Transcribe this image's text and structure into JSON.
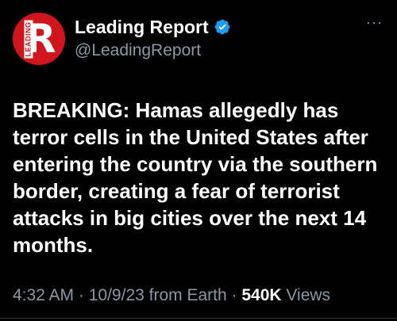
{
  "account": {
    "avatar_letter": "R",
    "avatar_word": "LEADING",
    "display_name": "Leading Report",
    "handle": "@LeadingReport",
    "verified_color": "#1d9bf0"
  },
  "menu": {
    "more_label": "···"
  },
  "tweet": {
    "text": "BREAKING: Hamas allegedly has terror cells in the United States after entering the country via the southern border, creating a fear of terrorist attacks in big cities over the next 14 months."
  },
  "meta": {
    "time": "4:32 AM",
    "date": "10/9/23",
    "source": "from Earth",
    "separator": " · ",
    "views_count": "540K",
    "views_label": "Views"
  },
  "colors": {
    "background": "#000000",
    "brand_red": "#d0151c",
    "muted": "#8b98a5"
  }
}
